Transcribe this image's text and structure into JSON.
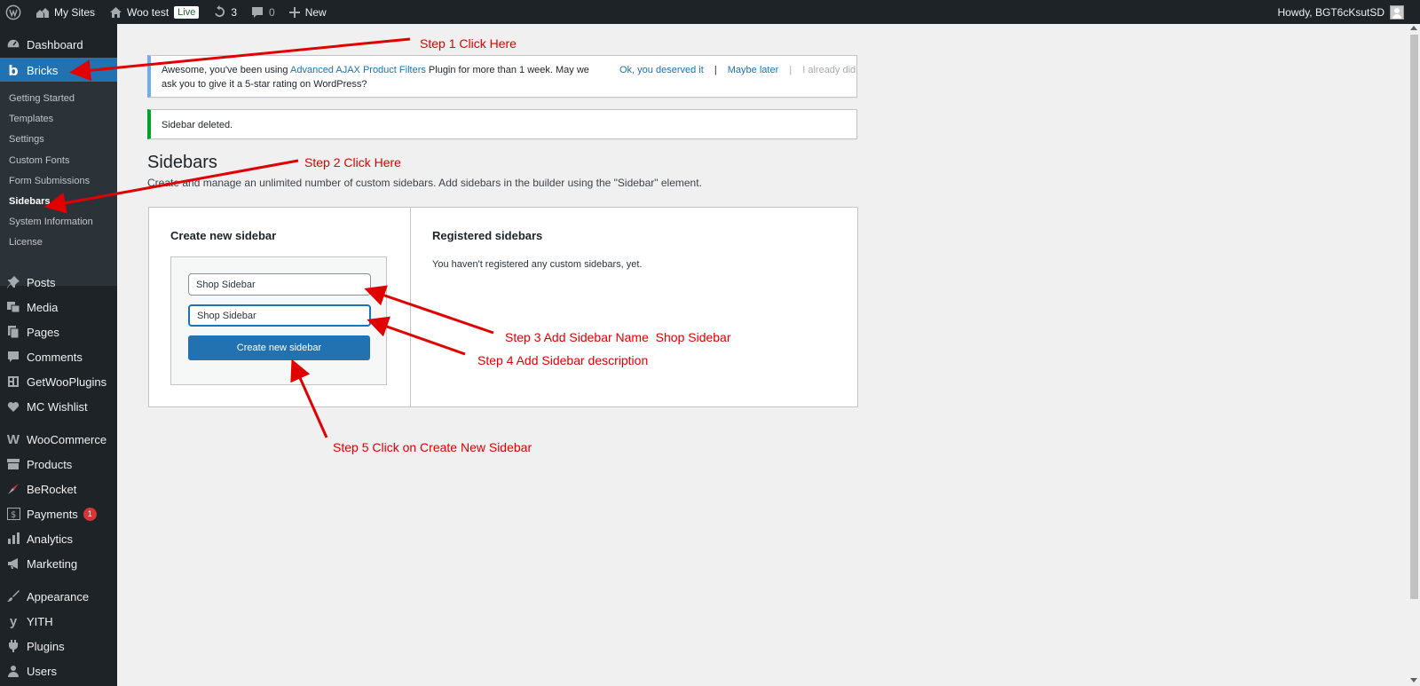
{
  "adminbar": {
    "wp_logo": "wordpress-icon",
    "my_sites": "My Sites",
    "site_name": "Woo test",
    "live_badge": "Live",
    "updates_count": "3",
    "comments_count": "0",
    "new_label": "New",
    "howdy": "Howdy, BGT6cKsutSD"
  },
  "menu": {
    "dashboard": "Dashboard",
    "bricks": "Bricks",
    "submenu": [
      "Getting Started",
      "Templates",
      "Settings",
      "Custom Fonts",
      "Form Submissions",
      "Sidebars",
      "System Information",
      "License"
    ],
    "items": [
      "Posts",
      "Media",
      "Pages",
      "Comments",
      "GetWooPlugins",
      "MC Wishlist",
      "WooCommerce",
      "Products",
      "BeRocket",
      "Payments",
      "Analytics",
      "Marketing",
      "Appearance",
      "YITH",
      "Plugins",
      "Users"
    ],
    "payments_badge": "1"
  },
  "notice_rating": {
    "text_before": "Awesome, you've been using ",
    "plugin_link": "Advanced AJAX Product Filters",
    "text_after": " Plugin for more than 1 week. May we ask you to give it a 5-star rating on WordPress?",
    "ok_link": "Ok, you deserved it",
    "sep": "|",
    "maybe_link": "Maybe later",
    "already_link": "I already did"
  },
  "notice_success": {
    "text": "Sidebar deleted."
  },
  "page": {
    "title": "Sidebars",
    "description": "Create and manage an unlimited number of custom sidebars. Add sidebars in the builder using the \"Sidebar\" element."
  },
  "create": {
    "title": "Create new sidebar",
    "name_value": "Shop Sidebar",
    "description_value": "Shop Sidebar",
    "button": "Create new sidebar"
  },
  "registered": {
    "title": "Registered sidebars",
    "empty": "You haven't registered any custom sidebars, yet."
  },
  "annotations": {
    "step1": "Step 1 Click Here",
    "step2": "Step 2 Click Here",
    "step3": "Step 3 Add Sidebar Name  Shop Sidebar",
    "step4": "Step 4 Add Sidebar description",
    "step5": "Step 5 Click on Create New Sidebar"
  },
  "colors": {
    "adminbar": "#1d2327",
    "menu_active": "#2271b1",
    "annotation": "#e00000",
    "notice_info": "#72aee6",
    "notice_success": "#00a32a"
  }
}
